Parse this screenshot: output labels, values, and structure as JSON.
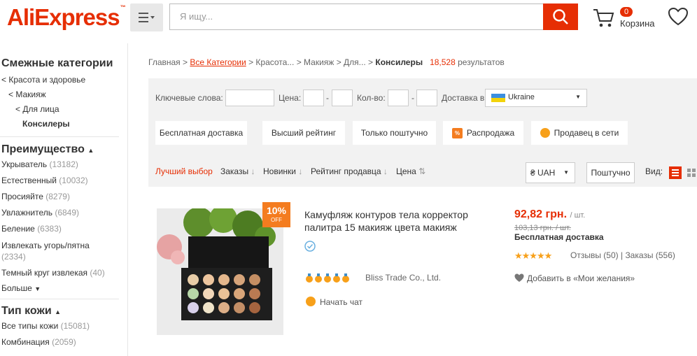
{
  "header": {
    "logo": "AliExpress",
    "search_placeholder": "Я ищу...",
    "cart_count": "0",
    "cart_label": "Корзина"
  },
  "sidebar": {
    "related_title": "Смежные категории",
    "related": [
      "< Красота и здоровье",
      "< Макияж",
      "< Для лица",
      "Консилеры"
    ],
    "benefit_title": "Преимущество",
    "benefits": [
      {
        "label": "Укрыватель",
        "count": "(13182)"
      },
      {
        "label": "Естественный",
        "count": "(10032)"
      },
      {
        "label": "Просияйте",
        "count": "(8279)"
      },
      {
        "label": "Увлажнитель",
        "count": "(6849)"
      },
      {
        "label": "Беление",
        "count": "(6383)"
      },
      {
        "label": "Извлекать угорь/пятна",
        "count": "(2334)"
      },
      {
        "label": "Темный круг извлекая",
        "count": "(40)"
      }
    ],
    "more_label": "Больше",
    "skin_title": "Тип кожи",
    "skin": [
      {
        "label": "Все типы кожи",
        "count": "(15081)"
      },
      {
        "label": "Комбинация",
        "count": "(2059)"
      }
    ]
  },
  "breadcrumb": {
    "home": "Главная",
    "sep": ">",
    "all": "Все Категории",
    "beauty": "Красота...",
    "makeup": "Макияж",
    "face": "Для...",
    "current": "Консилеры",
    "count": "18,528",
    "results": "результатов"
  },
  "filters": {
    "keywords": "Ключевые слова:",
    "price": "Цена:",
    "qty": "Кол-во:",
    "delivery": "Доставка в",
    "country": "Ukraine",
    "dash": "-",
    "buttons": [
      "Бесплатная доставка",
      "Высший рейтинг",
      "Только поштучно",
      "Распродажа",
      "Продавец в сети"
    ],
    "sort": {
      "best": "Лучший выбор",
      "orders": "Заказы",
      "new": "Новинки",
      "seller_rating": "Рейтинг продавца",
      "price": "Цена"
    },
    "currency": "₴ UAH",
    "per_piece": "Поштучно",
    "view_label": "Вид:"
  },
  "product": {
    "discount": "10%",
    "discount_off": "OFF",
    "title": "Камуфляж контуров тела корректор палитра 15 макияж цвета макияж",
    "price": "92,82 грн.",
    "per": "/ шт.",
    "old_price": "103,13 грн. / шт.",
    "free_shipping": "Бесплатная доставка",
    "stars": "★★★★★",
    "reviews": "Отзывы (50)",
    "orders": "Заказы (556)",
    "wishlist": "Добавить в «Мои желания»",
    "seller": "Bliss Trade Co., Ltd.",
    "chat": "Начать чат"
  },
  "colors": {
    "accent": "#e62e04",
    "orange": "#f47c1f",
    "star": "#f7a01a"
  }
}
